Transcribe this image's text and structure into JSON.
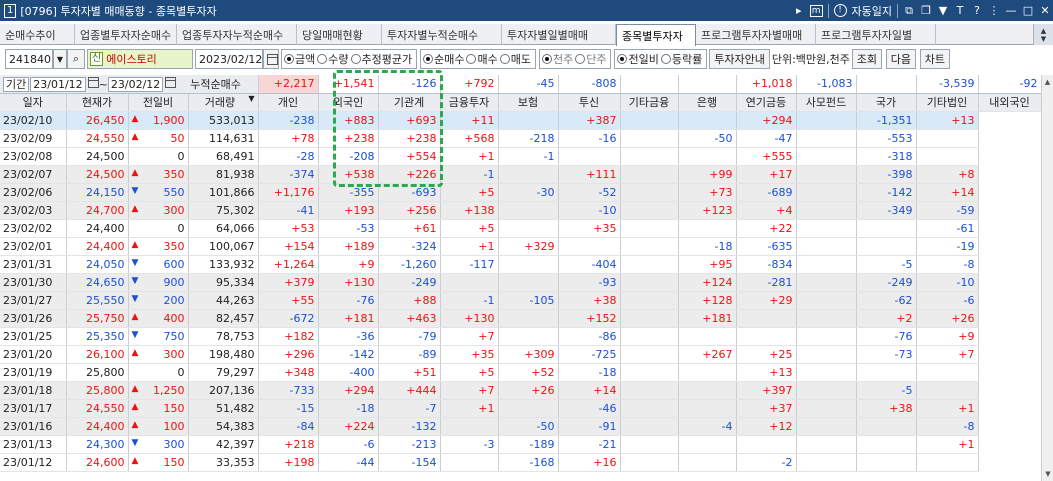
{
  "window": {
    "number": "1",
    "title": "[0796] 투자자별 매매동향 - 종목별투자자",
    "right_icons": [
      "play-icon",
      "m-icon",
      "info-icon",
      "restore-icon",
      "copy-icon",
      "pin-icon",
      "t-icon",
      "help-icon",
      "minimize-icon",
      "maximize-icon",
      "close-icon"
    ],
    "autolock": "자동일지"
  },
  "tabs": [
    "순매수추이",
    "업종별투자자순매수",
    "업종투자자누적순매수",
    "당일매매현황",
    "투자자별누적순매수",
    "투자자별일별매매",
    "종목별투자자",
    "프로그램투자자별매매",
    "프로그램투자자일별"
  ],
  "active_tab": 6,
  "toolbar1": {
    "code": "241840",
    "badge": "신",
    "stock_name": "에이스토리",
    "date": "2023/02/12",
    "radio_group1": [
      "금액",
      "수량",
      "추정평균가"
    ],
    "radio_group2": [
      "순매수",
      "매수",
      "매도"
    ],
    "radio_group3": [
      "천주",
      "단주"
    ],
    "radio_group4": [
      "전일비",
      "등락률"
    ],
    "guide_btn": "투자자안내",
    "unit": "단위:백만원,천주",
    "query_btn": "조회",
    "next_btn": "다음",
    "chart_btn": "차트"
  },
  "toolbar2": {
    "period_label": "기간",
    "from": "23/01/12",
    "tilde": "~",
    "to": "23/02/12"
  },
  "summary": {
    "label": "누적순매수",
    "values": [
      "+2,217",
      "+1,541",
      "-126",
      "+792",
      "-45",
      "-808",
      "",
      "",
      "+1,018",
      "-1,083",
      "",
      "-3,539",
      "-92"
    ]
  },
  "columns": [
    "일자",
    "현재가",
    "전일비",
    "거래량",
    "개인",
    "외국인",
    "기관계",
    "금융투자",
    "보험",
    "투신",
    "기타금융",
    "은행",
    "연기금등",
    "사모펀드",
    "국가",
    "기타법인",
    "내외국인"
  ],
  "rows": [
    [
      "23/02/10",
      "26,450",
      "up",
      "1,900",
      "533,013",
      "-238",
      "+883",
      "+693",
      "+11",
      "",
      "+387",
      "",
      "",
      "+294",
      "",
      "-1,351",
      "+13"
    ],
    [
      "23/02/09",
      "24,550",
      "up",
      "50",
      "114,631",
      "+78",
      "+238",
      "+238",
      "+568",
      "-218",
      "-16",
      "",
      "-50",
      "-47",
      "",
      "-553",
      ""
    ],
    [
      "23/02/08",
      "24,500",
      "none",
      "0",
      "68,491",
      "-28",
      "-208",
      "+554",
      "+1",
      "-1",
      "",
      "",
      "",
      "+555",
      "",
      "-318",
      ""
    ],
    [
      "23/02/07",
      "24,500",
      "up",
      "350",
      "81,938",
      "-374",
      "+538",
      "+226",
      "-1",
      "",
      "+111",
      "",
      "+99",
      "+17",
      "",
      "-398",
      "+8"
    ],
    [
      "23/02/06",
      "24,150",
      "down",
      "550",
      "101,866",
      "+1,176",
      "-355",
      "-693",
      "+5",
      "-30",
      "-52",
      "",
      "+73",
      "-689",
      "",
      "-142",
      "+14"
    ],
    [
      "23/02/03",
      "24,700",
      "up",
      "300",
      "75,302",
      "-41",
      "+193",
      "+256",
      "+138",
      "",
      "-10",
      "",
      "+123",
      "+4",
      "",
      "-349",
      "-59"
    ],
    [
      "23/02/02",
      "24,400",
      "none",
      "0",
      "64,066",
      "+53",
      "-53",
      "+61",
      "+5",
      "",
      "+35",
      "",
      "",
      "+22",
      "",
      "",
      "-61"
    ],
    [
      "23/02/01",
      "24,400",
      "up",
      "350",
      "100,067",
      "+154",
      "+189",
      "-324",
      "+1",
      "+329",
      "",
      "",
      "-18",
      "-635",
      "",
      "",
      "-19"
    ],
    [
      "23/01/31",
      "24,050",
      "down",
      "600",
      "133,932",
      "+1,264",
      "+9",
      "-1,260",
      "-117",
      "",
      "-404",
      "",
      "+95",
      "-834",
      "",
      "-5",
      "-8"
    ],
    [
      "23/01/30",
      "24,650",
      "down",
      "900",
      "95,334",
      "+379",
      "+130",
      "-249",
      "",
      "",
      "-93",
      "",
      "+124",
      "-281",
      "",
      "-249",
      "-10"
    ],
    [
      "23/01/27",
      "25,550",
      "down",
      "200",
      "44,263",
      "+55",
      "-76",
      "+88",
      "-1",
      "-105",
      "+38",
      "",
      "+128",
      "+29",
      "",
      "-62",
      "-6"
    ],
    [
      "23/01/26",
      "25,750",
      "up",
      "400",
      "82,457",
      "-672",
      "+181",
      "+463",
      "+130",
      "",
      "+152",
      "",
      "+181",
      "",
      "",
      "+2",
      "+26"
    ],
    [
      "23/01/25",
      "25,350",
      "down",
      "750",
      "78,753",
      "+182",
      "-36",
      "-79",
      "+7",
      "",
      "-86",
      "",
      "",
      "",
      "",
      "-76",
      "+9"
    ],
    [
      "23/01/20",
      "26,100",
      "up",
      "300",
      "198,480",
      "+296",
      "-142",
      "-89",
      "+35",
      "+309",
      "-725",
      "",
      "+267",
      "+25",
      "",
      "-73",
      "+7"
    ],
    [
      "23/01/19",
      "25,800",
      "none",
      "0",
      "79,297",
      "+348",
      "-400",
      "+51",
      "+5",
      "+52",
      "-18",
      "",
      "",
      "+13",
      "",
      "",
      ""
    ],
    [
      "23/01/18",
      "25,800",
      "up",
      "1,250",
      "207,136",
      "-733",
      "+294",
      "+444",
      "+7",
      "+26",
      "+14",
      "",
      "",
      "+397",
      "",
      "-5",
      ""
    ],
    [
      "23/01/17",
      "24,550",
      "up",
      "150",
      "51,482",
      "-15",
      "-18",
      "-7",
      "+1",
      "",
      "-46",
      "",
      "",
      "+37",
      "",
      "+38",
      "+1"
    ],
    [
      "23/01/16",
      "24,400",
      "up",
      "100",
      "54,383",
      "-84",
      "+224",
      "-132",
      "",
      "-50",
      "-91",
      "",
      "-4",
      "+12",
      "",
      "",
      "-8"
    ],
    [
      "23/01/13",
      "24,300",
      "down",
      "300",
      "42,397",
      "+218",
      "-6",
      "-213",
      "-3",
      "-189",
      "-21",
      "",
      "",
      "",
      "",
      "",
      "+1"
    ],
    [
      "23/01/12",
      "24,600",
      "up",
      "150",
      "33,353",
      "+198",
      "-44",
      "-154",
      "",
      "-168",
      "+16",
      "",
      "",
      "-2",
      "",
      "",
      ""
    ]
  ],
  "gray_rows": [
    3,
    4,
    5,
    9,
    10,
    11,
    15,
    16,
    17
  ]
}
